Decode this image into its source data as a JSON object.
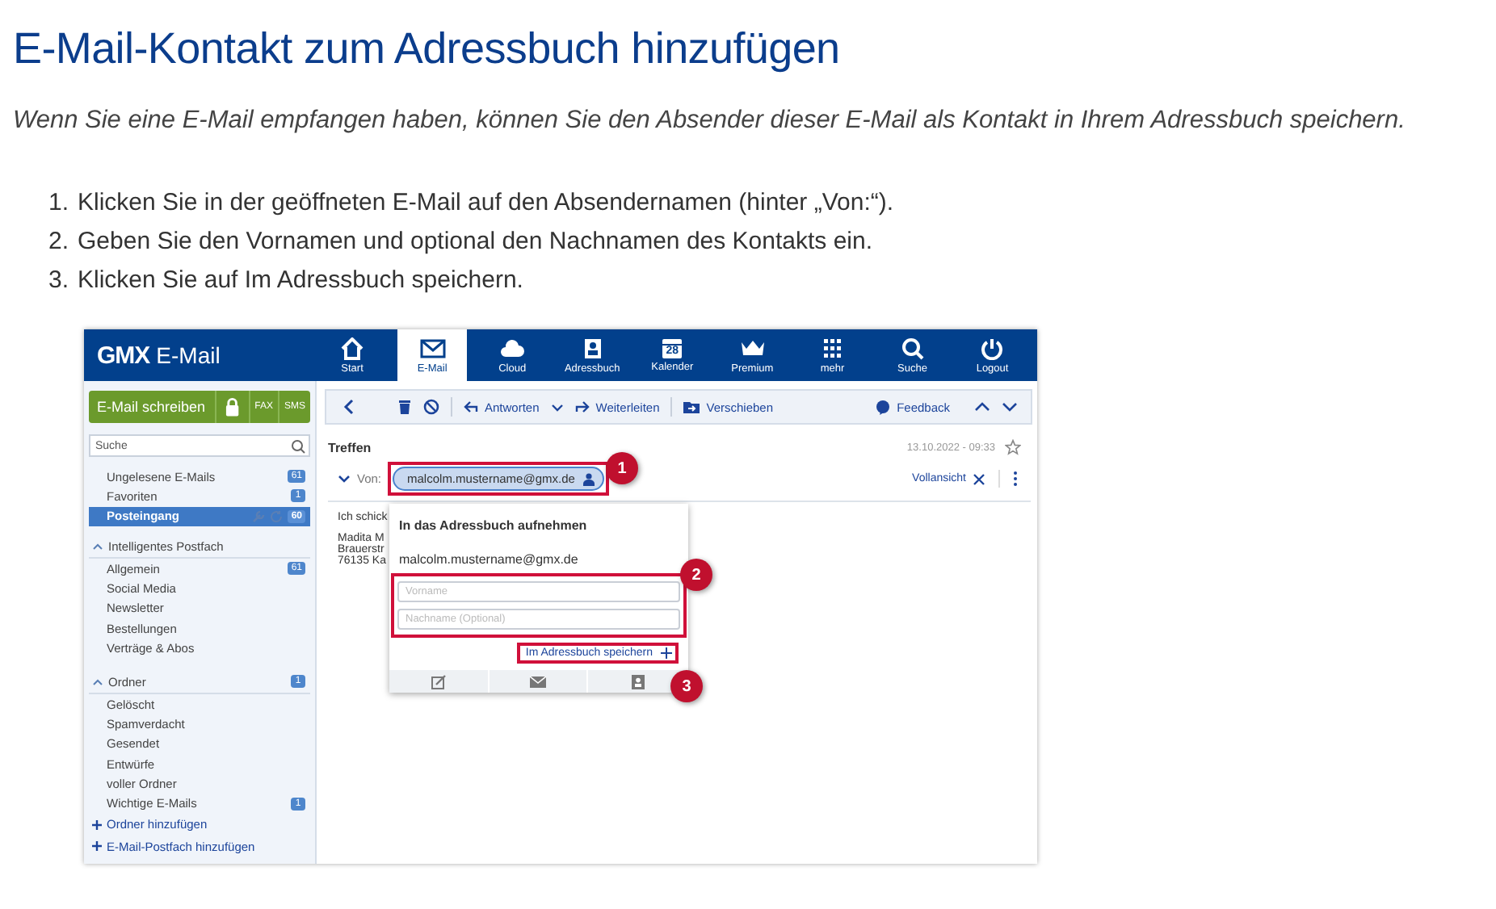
{
  "title": "E-Mail-Kontakt zum Adressbuch hinzufügen",
  "intro": "Wenn Sie eine E-Mail empfangen haben, können Sie den Absender dieser E-Mail als Kontakt in Ihrem Adressbuch speichern.",
  "steps": [
    {
      "number": "1.",
      "text": "Klicken Sie in der geöffneten E-Mail auf den Absendernamen (hinter „Von:“)."
    },
    {
      "number": "2.",
      "text": "Geben Sie den Vornamen und optional den Nachnamen des Kontakts ein."
    },
    {
      "number": "3.",
      "text": "Klicken Sie auf Im Adressbuch speichern."
    }
  ],
  "screenshot": {
    "brand": {
      "logo": "GMX",
      "product": "E-Mail"
    },
    "nav": [
      {
        "label": "Start",
        "selected": false
      },
      {
        "label": "E-Mail",
        "selected": true
      },
      {
        "label": "Cloud",
        "selected": false
      },
      {
        "label": "Adressbuch",
        "selected": false
      },
      {
        "label": "Kalender",
        "selected": false
      },
      {
        "label": "Premium",
        "selected": false
      },
      {
        "label": "mehr",
        "selected": false
      },
      {
        "label": "Suche",
        "selected": false
      },
      {
        "label": "Logout",
        "selected": false
      }
    ],
    "calendar_day": "28",
    "compose": {
      "label": "E-Mail schreiben",
      "fax": "FAX",
      "sms": "SMS"
    },
    "search_placeholder": "Suche",
    "folders": [
      {
        "label": "Ungelesene E-Mails",
        "badge": "61",
        "selected": false
      },
      {
        "label": "Favoriten",
        "badge": "1",
        "selected": false
      },
      {
        "label": "Posteingang",
        "badge": "60",
        "selected": true
      }
    ],
    "sections": [
      {
        "title": "Intelligentes Postfach",
        "expanded": true,
        "items": [
          {
            "label": "Allgemein",
            "badge": "61"
          },
          {
            "label": "Social Media"
          },
          {
            "label": "Newsletter"
          },
          {
            "label": "Bestellungen"
          },
          {
            "label": "Verträge & Abos"
          }
        ]
      },
      {
        "title": "Ordner",
        "badge": "1",
        "expanded": true,
        "items": [
          {
            "label": "Gelöscht"
          },
          {
            "label": "Spamverdacht"
          },
          {
            "label": "Gesendet"
          },
          {
            "label": "Entwürfe"
          },
          {
            "label": "voller Ordner"
          },
          {
            "label": "Wichtige E-Mails",
            "badge": "1"
          }
        ]
      }
    ],
    "add_links": [
      "Ordner hinzufügen",
      "E-Mail-Postfach hinzufügen"
    ],
    "toolbar": {
      "reply": "Antworten",
      "forward": "Weiterleiten",
      "move": "Verschieben",
      "feedback": "Feedback"
    },
    "message": {
      "subject": "Treffen",
      "date": "13.10.2022 - 09:33",
      "from_label": "Von:",
      "sender": "malcolm.mustername@gmx.de",
      "full_view": "Vollansicht",
      "body": [
        "Ich schick",
        "Madita M",
        "Brauerstr",
        "76135 Ka"
      ]
    },
    "popup": {
      "title": "In das Adressbuch aufnehmen",
      "email": "malcolm.mustername@gmx.de",
      "first_name_placeholder": "Vorname",
      "last_name_placeholder": "Nachname (Optional)",
      "save": "Im Adressbuch speichern"
    },
    "callouts": [
      "1",
      "2",
      "3"
    ]
  }
}
